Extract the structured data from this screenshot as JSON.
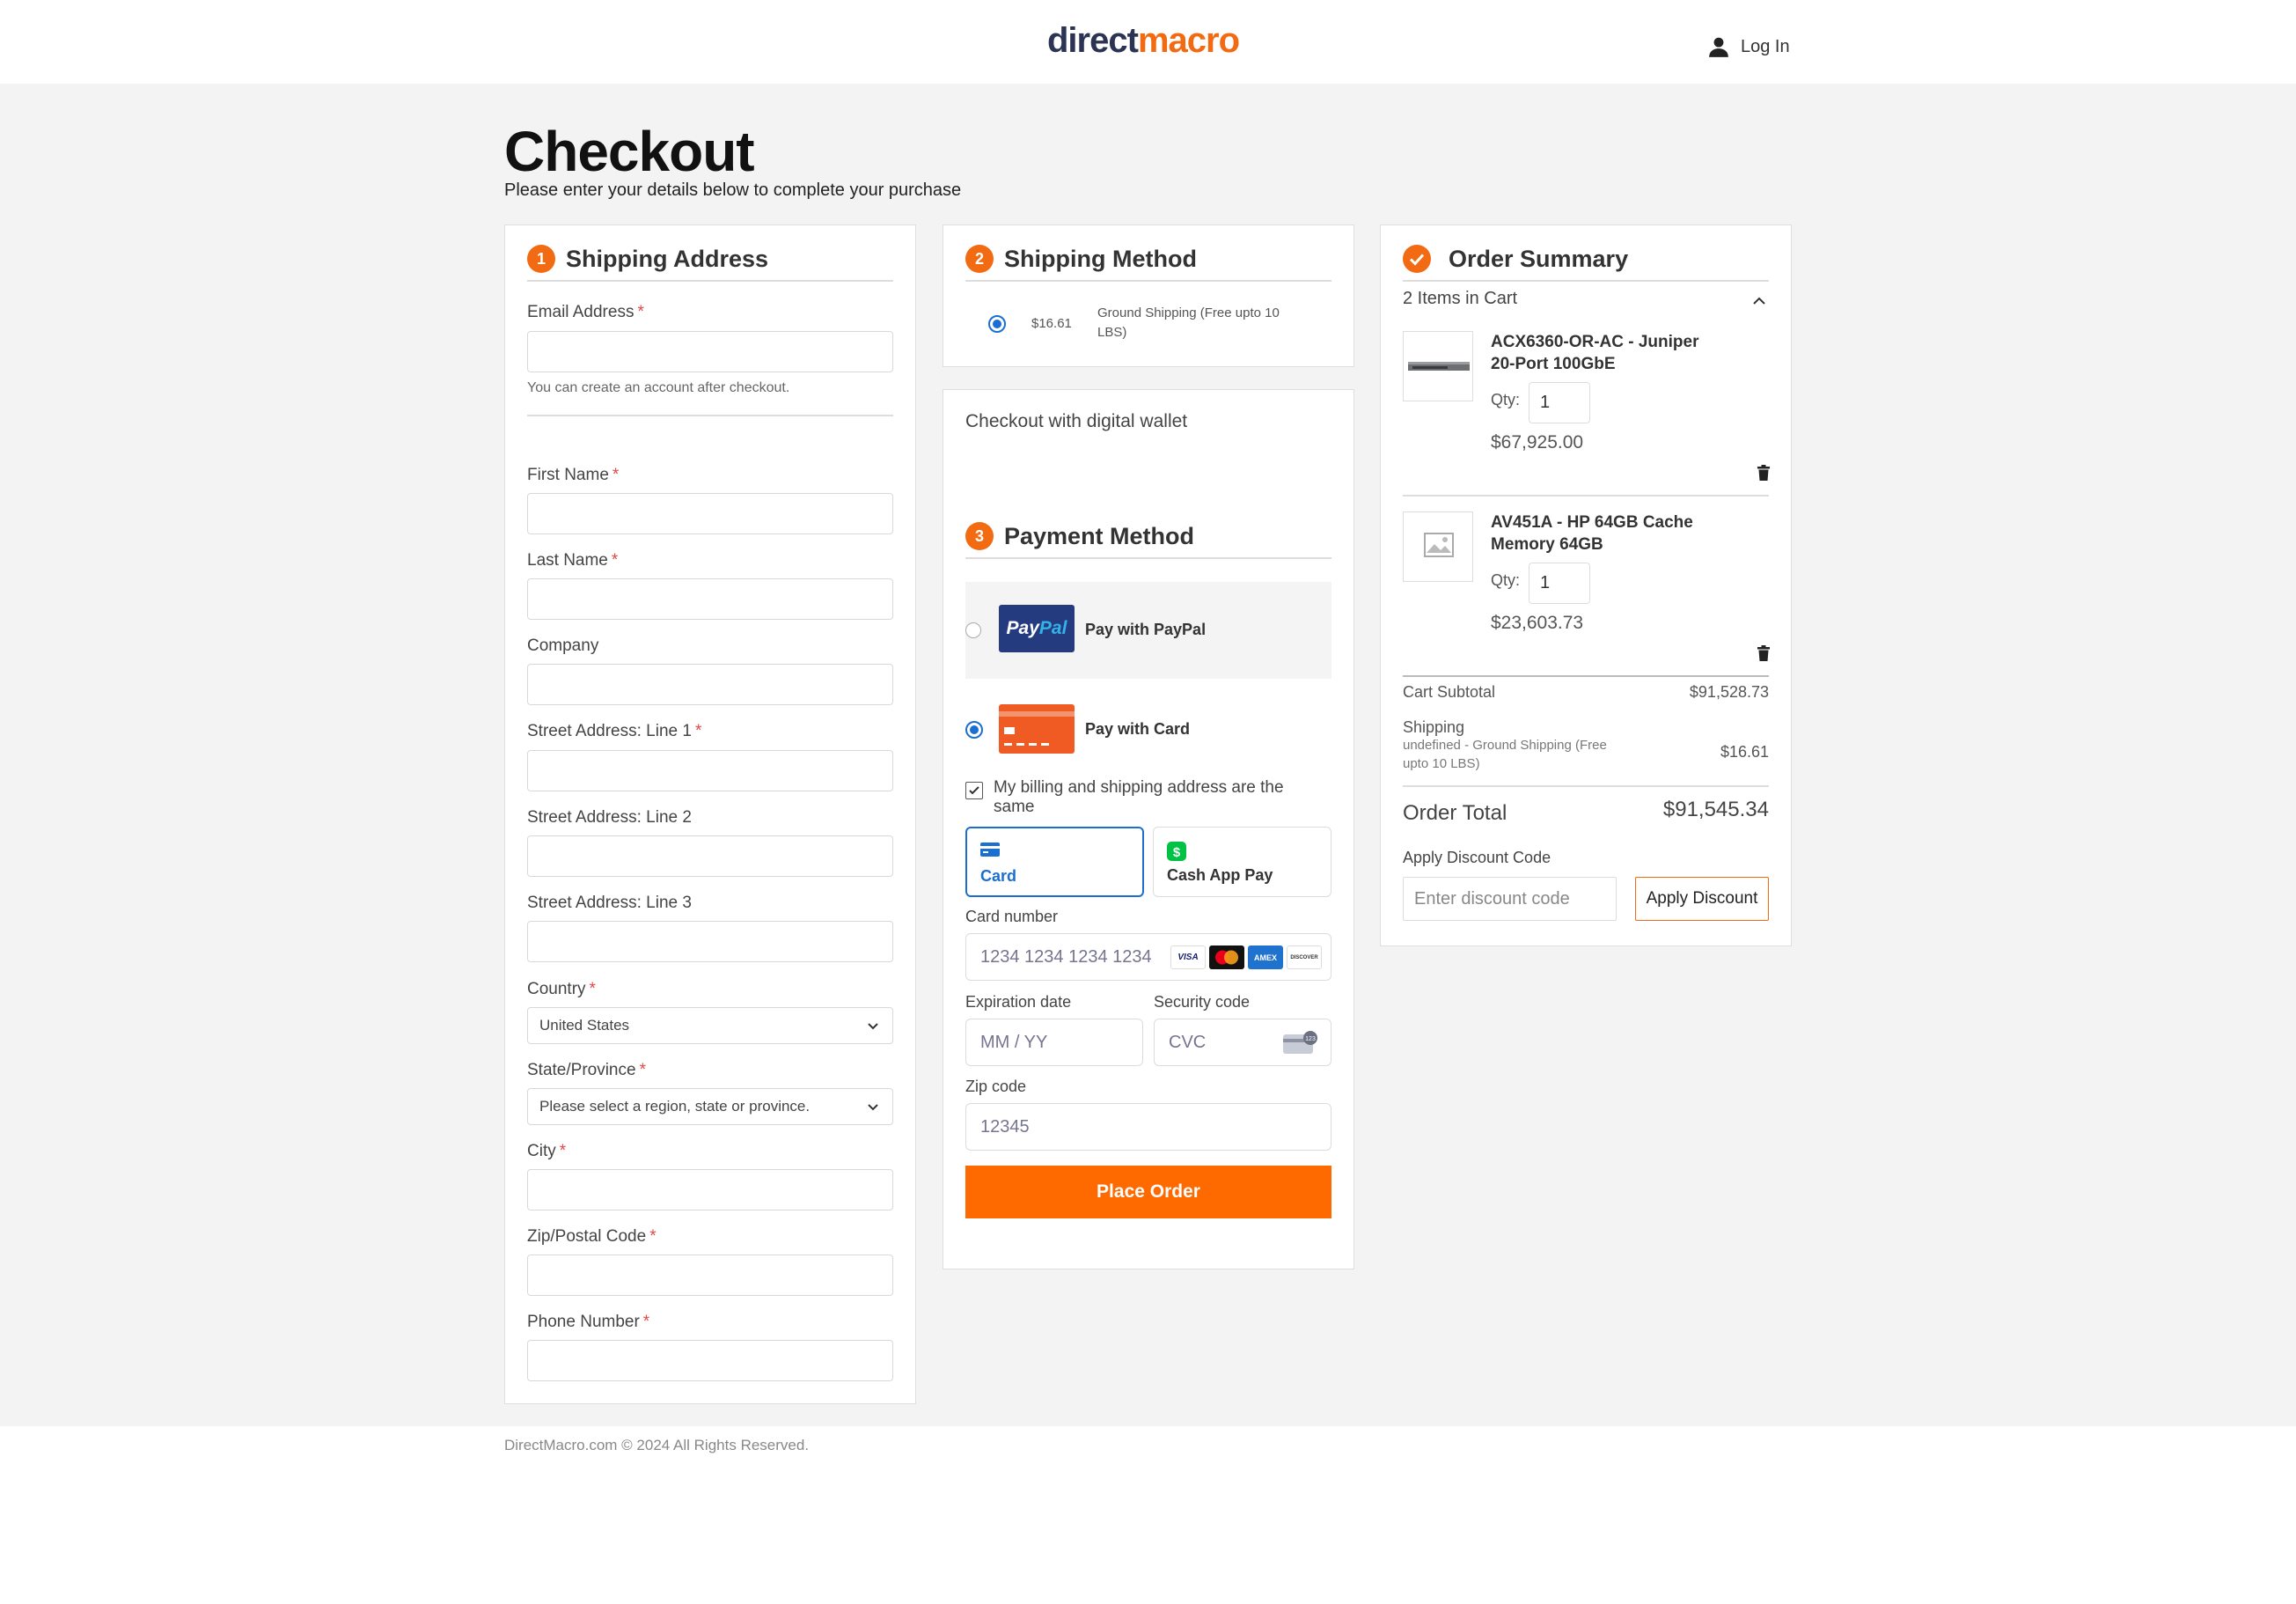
{
  "header": {
    "logo_part1": "direct",
    "logo_part2": "macro",
    "login_label": "Log In"
  },
  "page": {
    "title": "Checkout",
    "subtitle": "Please enter your details below to complete your purchase"
  },
  "shipping_address": {
    "step": "1",
    "title": "Shipping Address",
    "email_label": "Email Address",
    "email_help": "You can create an account after checkout.",
    "first_name_label": "First Name",
    "last_name_label": "Last Name",
    "company_label": "Company",
    "street1_label": "Street Address: Line 1",
    "street2_label": "Street Address: Line 2",
    "street3_label": "Street Address: Line 3",
    "country_label": "Country",
    "country_value": "United States",
    "state_label": "State/Province",
    "state_value": "Please select a region, state or province.",
    "city_label": "City",
    "zip_label": "Zip/Postal Code",
    "phone_label": "Phone Number",
    "required_mark": "*"
  },
  "shipping_method": {
    "step": "2",
    "title": "Shipping Method",
    "option_price": "$16.61",
    "option_label": "Ground Shipping (Free upto 10 LBS)"
  },
  "payment": {
    "wallet_label": "Checkout with digital wallet",
    "step": "3",
    "title": "Payment Method",
    "paypal_logo_a": "Pay",
    "paypal_logo_b": "Pal",
    "paypal_label": "Pay with PayPal",
    "card_label": "Pay with Card",
    "same_address_label": "My billing and shipping address are the same",
    "tab_card": "Card",
    "tab_cashapp": "Cash App Pay",
    "card_number_label": "Card number",
    "card_number_placeholder": "1234 1234 1234 1234",
    "brands": [
      "VISA",
      "MC",
      "AMEX",
      "DISCOVER"
    ],
    "expiry_label": "Expiration date",
    "expiry_placeholder": "MM / YY",
    "cvc_label": "Security code",
    "cvc_placeholder": "CVC",
    "zip_label": "Zip code",
    "zip_placeholder": "12345",
    "place_order": "Place Order"
  },
  "summary": {
    "title": "Order Summary",
    "items_count": "2 Items in Cart",
    "items": [
      {
        "name_line1": "ACX6360-OR-AC - Juniper",
        "name_line2": "20-Port 100GbE",
        "qty_label": "Qty:",
        "qty": "1",
        "price": "$67,925.00"
      },
      {
        "name_line1": "AV451A - HP 64GB Cache",
        "name_line2": "Memory 64GB",
        "qty_label": "Qty:",
        "qty": "1",
        "price": "$23,603.73"
      }
    ],
    "subtotal_label": "Cart Subtotal",
    "subtotal_value": "$91,528.73",
    "shipping_label": "Shipping",
    "shipping_desc_line1": "undefined - Ground Shipping (Free",
    "shipping_desc_line2": "upto 10 LBS)",
    "shipping_value": "$16.61",
    "total_label": "Order Total",
    "total_value": "$91,545.34",
    "discount_label": "Apply Discount Code",
    "discount_placeholder": "Enter discount code",
    "discount_button": "Apply Discount"
  },
  "footer": {
    "text": "DirectMacro.com © 2024 All Rights Reserved."
  },
  "colors": {
    "accent": "#f26b12",
    "place_order": "#ff6a00",
    "stripe_blue": "#1a6fd1",
    "brand_navy": "#2c3454"
  }
}
